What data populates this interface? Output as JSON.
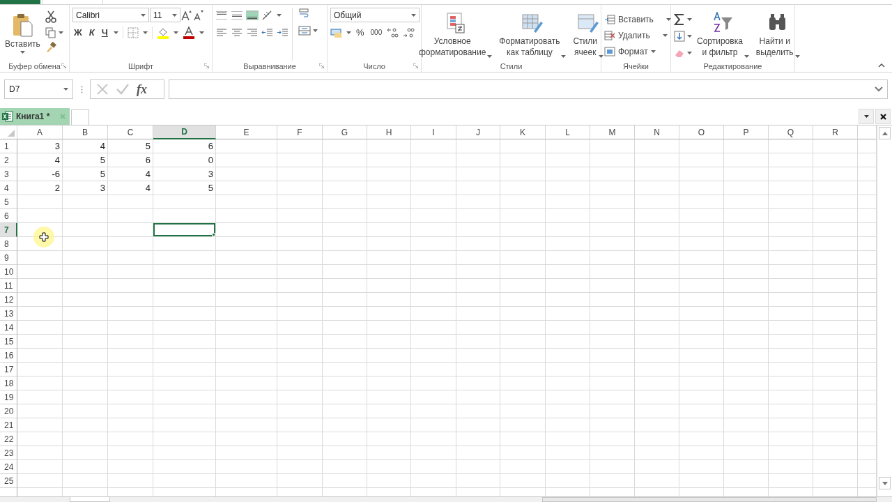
{
  "ribbon": {
    "clipboard": {
      "paste": "Вставить",
      "title": "Буфер обмена"
    },
    "font": {
      "name": "Calibri",
      "size": "11",
      "bold": "Ж",
      "italic": "К",
      "underline": "Ч",
      "title": "Шрифт"
    },
    "alignment": {
      "title": "Выравнивание",
      "vertical": [
        {
          "kind": "top",
          "selected": false
        },
        {
          "kind": "middle",
          "selected": false
        },
        {
          "kind": "bottom",
          "selected": true
        }
      ]
    },
    "number": {
      "format": "Общий",
      "percent": "%",
      "thousands": "000",
      "title": "Число"
    },
    "styles": {
      "title": "Стили",
      "buttons": [
        {
          "label": "Условное\nформатирование",
          "kind": "conditional"
        },
        {
          "label": "Форматировать\nкак таблицу",
          "kind": "table"
        },
        {
          "label": "Стили\nячеек",
          "kind": "cell-styles"
        }
      ]
    },
    "cells": {
      "title": "Ячейки",
      "buttons": [
        {
          "label": "Вставить",
          "kind": "insert"
        },
        {
          "label": "Удалить",
          "kind": "delete"
        },
        {
          "label": "Формат",
          "kind": "format"
        }
      ]
    },
    "editing": {
      "title": "Редактирование",
      "buttons": [
        {
          "label": "Сортировка\nи фильтр",
          "kind": "sort"
        },
        {
          "label": "Найти и\nвыделить",
          "kind": "find"
        }
      ]
    }
  },
  "name_box": "D7",
  "function_label": "fx",
  "workbook_tab": {
    "label": "Книга1 *"
  },
  "columns": [
    {
      "label": "A",
      "selected": false
    },
    {
      "label": "B",
      "selected": false
    },
    {
      "label": "C",
      "selected": false
    },
    {
      "label": "D",
      "selected": true
    },
    {
      "label": "E",
      "selected": false
    },
    {
      "label": "F",
      "selected": false
    },
    {
      "label": "G",
      "selected": false
    },
    {
      "label": "H",
      "selected": false
    },
    {
      "label": "I",
      "selected": false
    },
    {
      "label": "J",
      "selected": false
    },
    {
      "label": "K",
      "selected": false
    },
    {
      "label": "L",
      "selected": false
    },
    {
      "label": "M",
      "selected": false
    },
    {
      "label": "N",
      "selected": false
    },
    {
      "label": "O",
      "selected": false
    },
    {
      "label": "P",
      "selected": false
    },
    {
      "label": "Q",
      "selected": false
    },
    {
      "label": "R",
      "selected": false
    }
  ],
  "rows": [
    {
      "label": "1",
      "selected": false,
      "cells": [
        "3",
        "4",
        "5",
        "6"
      ]
    },
    {
      "label": "2",
      "selected": false,
      "cells": [
        "4",
        "5",
        "6",
        "0"
      ]
    },
    {
      "label": "3",
      "selected": false,
      "cells": [
        "-6",
        "5",
        "4",
        "3"
      ]
    },
    {
      "label": "4",
      "selected": false,
      "cells": [
        "2",
        "3",
        "4",
        "5"
      ]
    },
    {
      "label": "5",
      "selected": false
    },
    {
      "label": "6",
      "selected": false
    },
    {
      "label": "7",
      "selected": true
    },
    {
      "label": "8",
      "selected": false
    },
    {
      "label": "9",
      "selected": false
    },
    {
      "label": "10",
      "selected": false
    },
    {
      "label": "11",
      "selected": false
    },
    {
      "label": "12",
      "selected": false
    },
    {
      "label": "13",
      "selected": false
    },
    {
      "label": "14",
      "selected": false
    },
    {
      "label": "15",
      "selected": false
    },
    {
      "label": "16",
      "selected": false
    },
    {
      "label": "17",
      "selected": false
    },
    {
      "label": "18",
      "selected": false
    },
    {
      "label": "19",
      "selected": false
    },
    {
      "label": "20",
      "selected": false
    },
    {
      "label": "21",
      "selected": false
    },
    {
      "label": "22",
      "selected": false
    },
    {
      "label": "23",
      "selected": false
    },
    {
      "label": "24",
      "selected": false
    },
    {
      "label": "25",
      "selected": false
    }
  ]
}
